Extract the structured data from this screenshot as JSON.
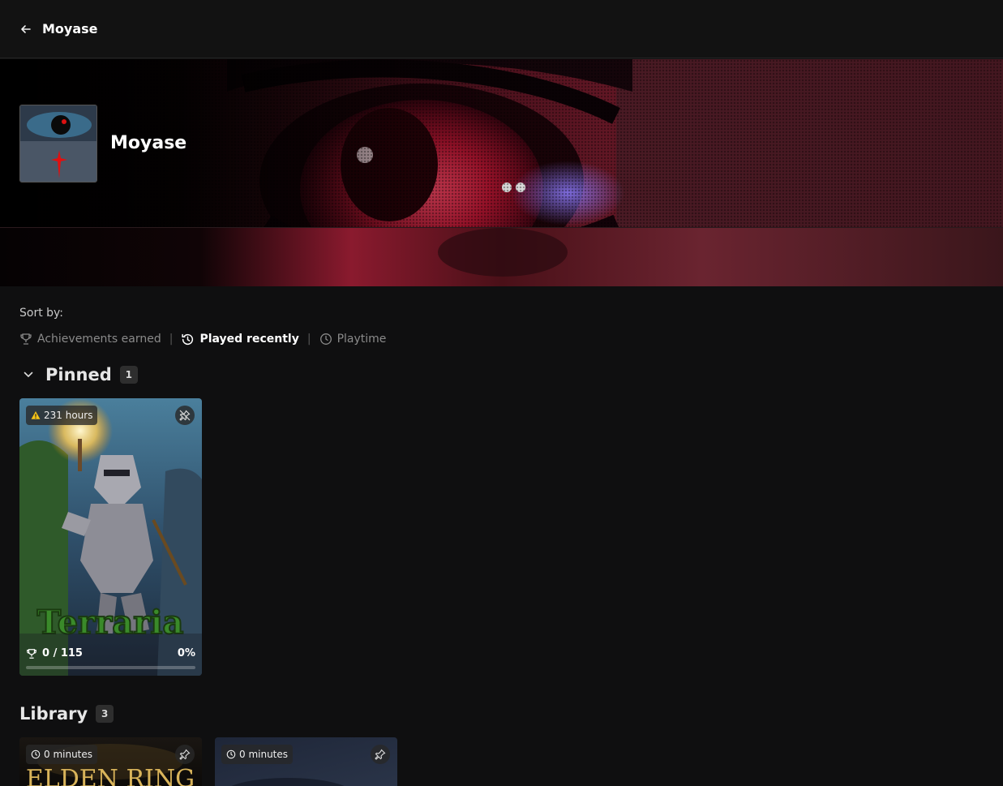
{
  "header": {
    "title": "Moyase"
  },
  "profile": {
    "name": "Moyase"
  },
  "sort": {
    "label": "Sort by:",
    "options": [
      {
        "label": "Achievements earned",
        "icon": "trophy-icon",
        "active": false
      },
      {
        "label": "Played recently",
        "icon": "history-icon",
        "active": true
      },
      {
        "label": "Playtime",
        "icon": "clock-icon",
        "active": false
      }
    ],
    "separator": "|"
  },
  "pinned": {
    "title": "Pinned",
    "count": "1",
    "games": [
      {
        "title": "Terraria",
        "playtime": "231 hours",
        "playtime_icon": "warning-icon",
        "achievements": "0 / 115",
        "percent": "0%",
        "progress": 0
      }
    ]
  },
  "library": {
    "title": "Library",
    "count": "3",
    "games": [
      {
        "title": "ELDEN RING",
        "playtime": "0 minutes",
        "playtime_icon": "clock-icon"
      },
      {
        "title": "",
        "playtime": "0 minutes",
        "playtime_icon": "clock-icon"
      }
    ]
  },
  "colors": {
    "background": "#0f0f10",
    "topbar": "#121212",
    "accent_red": "#c21a3a",
    "badge": "#2e2e2e"
  }
}
